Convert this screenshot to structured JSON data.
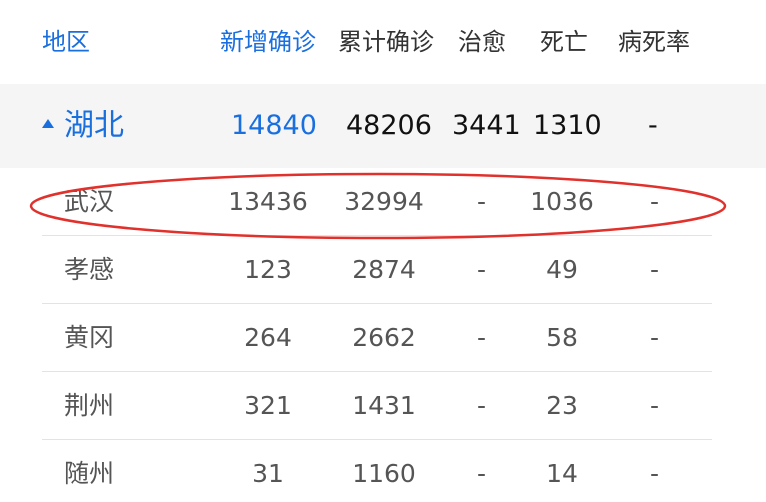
{
  "header": {
    "region": "地区",
    "new_confirmed": "新增确诊",
    "total_confirmed": "累计确诊",
    "cured": "治愈",
    "deaths": "死亡",
    "fatality_rate": "病死率"
  },
  "province": {
    "name": "湖北",
    "new_confirmed": "14840",
    "total_confirmed": "48206",
    "cured": "3441",
    "deaths": "1310",
    "fatality_rate": "-"
  },
  "cities": [
    {
      "name": "武汉",
      "new_confirmed": "13436",
      "total_confirmed": "32994",
      "cured": "-",
      "deaths": "1036",
      "fatality_rate": "-"
    },
    {
      "name": "孝感",
      "new_confirmed": "123",
      "total_confirmed": "2874",
      "cured": "-",
      "deaths": "49",
      "fatality_rate": "-"
    },
    {
      "name": "黄冈",
      "new_confirmed": "264",
      "total_confirmed": "2662",
      "cured": "-",
      "deaths": "58",
      "fatality_rate": "-"
    },
    {
      "name": "荆州",
      "new_confirmed": "321",
      "total_confirmed": "1431",
      "cured": "-",
      "deaths": "23",
      "fatality_rate": "-"
    },
    {
      "name": "随州",
      "new_confirmed": "31",
      "total_confirmed": "1160",
      "cured": "-",
      "deaths": "14",
      "fatality_rate": "-"
    }
  ],
  "colors": {
    "accent": "#1a6fdf",
    "annotation": "#e0312c",
    "province_bg": "#f5f5f5"
  },
  "icons": {
    "expand": "caret-up-icon"
  }
}
